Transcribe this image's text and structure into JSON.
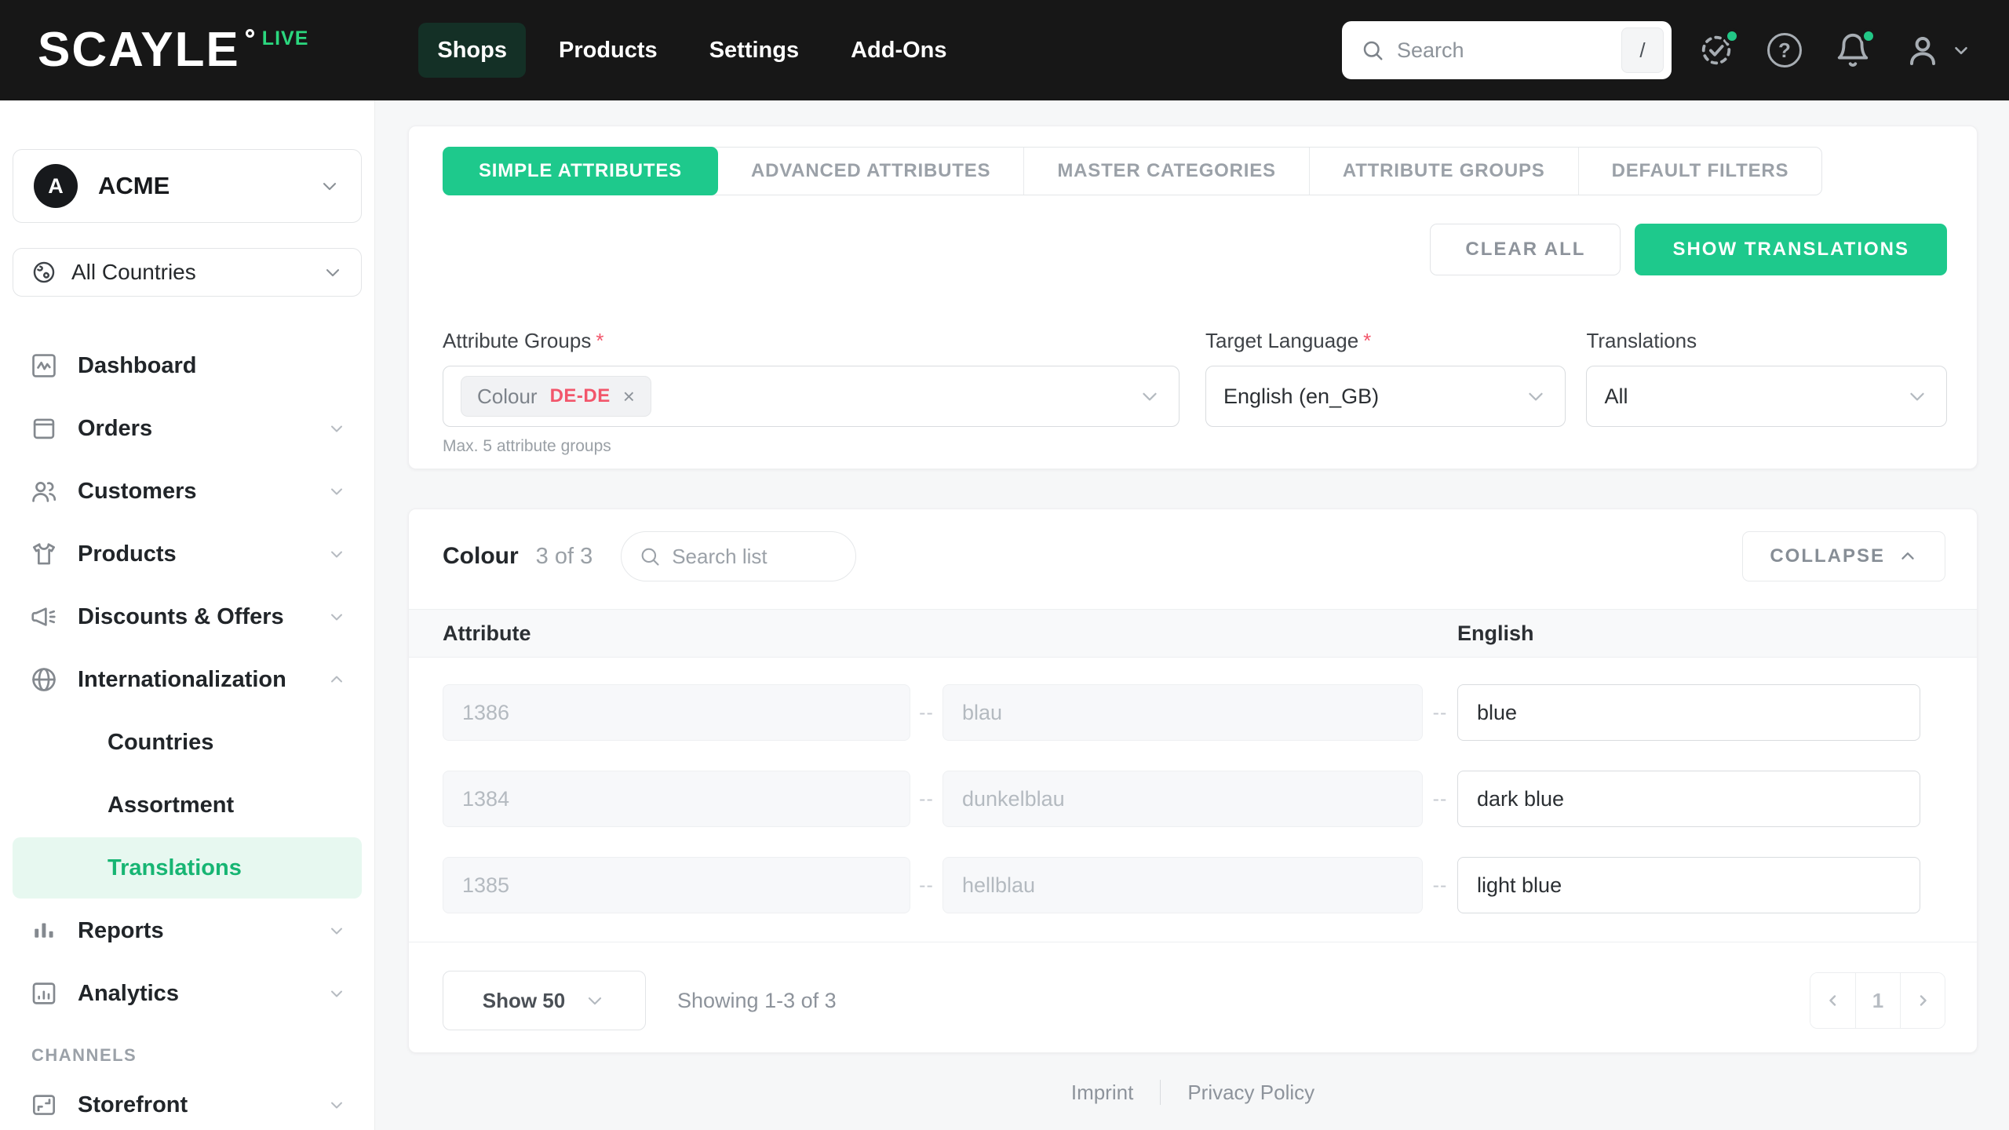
{
  "colors": {
    "brand_green": "#1ec98c",
    "live_green": "#2bd77e",
    "topnav_active_bg": "#143026",
    "sidebar_active_bg": "#e7f8f0",
    "sidebar_active_text": "#17b573",
    "chip_locale_red": "#f2566b",
    "topbar_bg": "#171717"
  },
  "topbar": {
    "logo": "SCAYLE",
    "live_badge": "LIVE",
    "nav": [
      {
        "label": "Shops",
        "active": true
      },
      {
        "label": "Products",
        "active": false
      },
      {
        "label": "Settings",
        "active": false
      },
      {
        "label": "Add-Ons",
        "active": false
      }
    ],
    "search": {
      "placeholder": "Search",
      "shortcut_key": "/"
    },
    "help_glyph": "?"
  },
  "sidebar": {
    "account": {
      "initial": "A",
      "name": "ACME"
    },
    "region": {
      "label": "All Countries"
    },
    "menu": [
      {
        "label": "Dashboard"
      },
      {
        "label": "Orders"
      },
      {
        "label": "Customers"
      },
      {
        "label": "Products"
      },
      {
        "label": "Discounts & Offers"
      },
      {
        "label": "Internationalization"
      }
    ],
    "submenu": [
      {
        "label": "Countries",
        "active": false
      },
      {
        "label": "Assortment",
        "active": false
      },
      {
        "label": "Translations",
        "active": true
      }
    ],
    "menu2": [
      {
        "label": "Reports"
      },
      {
        "label": "Analytics"
      }
    ],
    "section_label": "CHANNELS",
    "channels": [
      {
        "label": "Storefront"
      }
    ]
  },
  "content": {
    "tabs": [
      {
        "label": "SIMPLE ATTRIBUTES",
        "active": true
      },
      {
        "label": "ADVANCED ATTRIBUTES",
        "active": false
      },
      {
        "label": "MASTER CATEGORIES",
        "active": false
      },
      {
        "label": "ATTRIBUTE GROUPS",
        "active": false
      },
      {
        "label": "DEFAULT FILTERS",
        "active": false
      }
    ],
    "actions": {
      "clear_all": "CLEAR ALL",
      "show_translations": "SHOW TRANSLATIONS"
    },
    "filters": {
      "required_marker": "*",
      "attribute_groups": {
        "label": "Attribute Groups",
        "chip_name": "Colour",
        "chip_locale": "DE-DE",
        "chip_remove": "×",
        "helper": "Max. 5 attribute groups"
      },
      "target_language": {
        "label": "Target Language",
        "value": "English (en_GB)"
      },
      "translations": {
        "label": "Translations",
        "value": "All"
      }
    },
    "table": {
      "title": "Colour",
      "count": "3 of 3",
      "search_placeholder": "Search list",
      "collapse_label": "COLLAPSE",
      "col_attribute": "Attribute",
      "col_language": "English",
      "dash": "--",
      "rows": [
        {
          "id": "1386",
          "source": "blau",
          "translation": "blue"
        },
        {
          "id": "1384",
          "source": "dunkelblau",
          "translation": "dark blue"
        },
        {
          "id": "1385",
          "source": "hellblau",
          "translation": "light blue"
        }
      ],
      "footer": {
        "page_size": "Show 50",
        "showing": "Showing 1-3 of 3",
        "page": "1"
      }
    },
    "footer_links": [
      {
        "label": "Imprint"
      },
      {
        "label": "Privacy Policy"
      }
    ]
  }
}
